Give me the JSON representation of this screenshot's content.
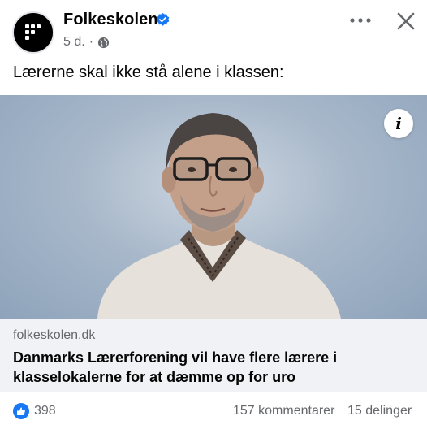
{
  "post": {
    "page_name": "Folkeskolen",
    "age": "5 d.",
    "separator": "·",
    "text": "Lærerne skal ikke stå alene i klassen:"
  },
  "link": {
    "domain": "folkeskolen.dk",
    "title": "Danmarks Lærerforening vil have flere lærere i klasselokalerne for at dæmme op for uro"
  },
  "reactions": {
    "likes": "398",
    "comments": "157 kommentarer",
    "shares": "15 delinger"
  },
  "icons": {
    "info": "i",
    "verified": "verified-badge-icon",
    "audience": "globe-icon",
    "more": "more-options-icon",
    "close": "close-icon",
    "like": "thumbs-up-icon"
  },
  "colors": {
    "accent": "#1877f2",
    "secondary_text": "#65676b",
    "link_background": "#f0f2f5"
  }
}
